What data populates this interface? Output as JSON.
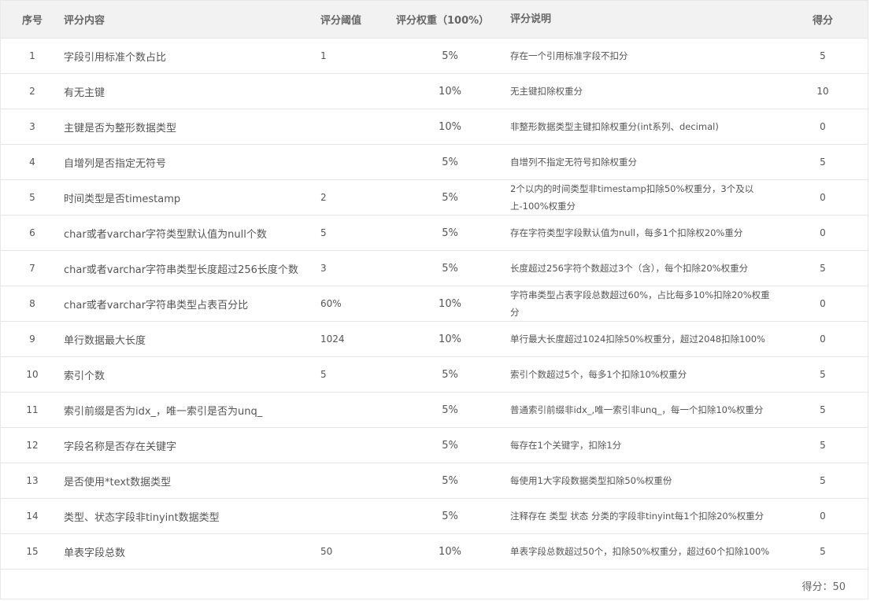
{
  "headers": {
    "idx": "序号",
    "content": "评分内容",
    "threshold": "评分阈值",
    "weight": "评分权重（100%）",
    "desc": "评分说明",
    "score": "得分"
  },
  "rows": [
    {
      "idx": "1",
      "content": "字段引用标准个数占比",
      "threshold": "1",
      "weight": "5%",
      "desc": "存在一个引用标准字段不扣分",
      "score": "5"
    },
    {
      "idx": "2",
      "content": "有无主键",
      "threshold": "",
      "weight": "10%",
      "desc": "无主键扣除权重分",
      "score": "10"
    },
    {
      "idx": "3",
      "content": "主键是否为整形数据类型",
      "threshold": "",
      "weight": "10%",
      "desc": "非整形数据类型主键扣除权重分(int系列、decimal)",
      "score": "0"
    },
    {
      "idx": "4",
      "content": "自增列是否指定无符号",
      "threshold": "",
      "weight": "5%",
      "desc": "自增列不指定无符号扣除权重分",
      "score": "5"
    },
    {
      "idx": "5",
      "content": "时间类型是否timestamp",
      "threshold": "2",
      "weight": "5%",
      "desc": "2个以内的时间类型非timestamp扣除50%权重分，3个及以上-100%权重分",
      "score": "0"
    },
    {
      "idx": "6",
      "content": "char或者varchar字符类型默认值为null个数",
      "threshold": "5",
      "weight": "5%",
      "desc": "存在字符类型字段默认值为null，每多1个扣除权20%重分",
      "score": "0"
    },
    {
      "idx": "7",
      "content": "char或者varchar字符串类型长度超过256长度个数",
      "threshold": "3",
      "weight": "5%",
      "desc": "长度超过256字符个数超过3个（含），每个扣除20%权重分",
      "score": "5"
    },
    {
      "idx": "8",
      "content": "char或者varchar字符串类型占表百分比",
      "threshold": "60%",
      "weight": "10%",
      "desc": "字符串类型占表字段总数超过60%，占比每多10%扣除20%权重分",
      "score": "0"
    },
    {
      "idx": "9",
      "content": "单行数据最大长度",
      "threshold": "1024",
      "weight": "10%",
      "desc": "单行最大长度超过1024扣除50%权重分，超过2048扣除100%",
      "score": "0"
    },
    {
      "idx": "10",
      "content": "索引个数",
      "threshold": "5",
      "weight": "5%",
      "desc": "索引个数超过5个，每多1个扣除10%权重分",
      "score": "5"
    },
    {
      "idx": "11",
      "content": "索引前缀是否为idx_，唯一索引是否为unq_",
      "threshold": "",
      "weight": "5%",
      "desc": "普通索引前缀非idx_,唯一索引非unq_，每一个扣除10%权重分",
      "score": "5"
    },
    {
      "idx": "12",
      "content": "字段名称是否存在关键字",
      "threshold": "",
      "weight": "5%",
      "desc": "每存在1个关键字，扣除1分",
      "score": "5"
    },
    {
      "idx": "13",
      "content": "是否使用*text数据类型",
      "threshold": "",
      "weight": "5%",
      "desc": "每使用1大字段数据类型扣除50%权重份",
      "score": "5"
    },
    {
      "idx": "14",
      "content": "类型、状态字段非tinyint数据类型",
      "threshold": "",
      "weight": "5%",
      "desc": "注释存在 类型 状态 分类的字段非tinyint每1个扣除20%权重分",
      "score": "0"
    },
    {
      "idx": "15",
      "content": "单表字段总数",
      "threshold": "50",
      "weight": "10%",
      "desc": "单表字段总数超过50个，扣除50%权重分，超过60个扣除100%",
      "score": "5"
    }
  ],
  "footer": {
    "total_text": "得分：50"
  }
}
